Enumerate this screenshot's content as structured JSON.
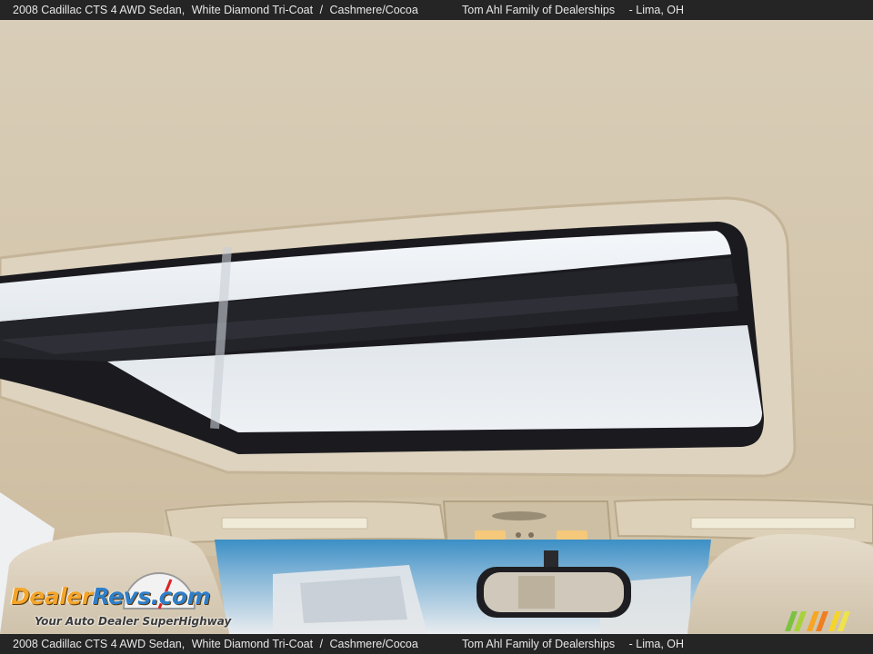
{
  "caption": {
    "vehicle": "2008 Cadillac CTS 4 AWD Sedan,",
    "color": "White Diamond Tri-Coat",
    "separator": "/",
    "interior": "Cashmere/Cocoa",
    "dealer": "Tom Ahl Family of Dealerships",
    "location": "-  Lima, OH"
  },
  "watermark": {
    "brand_part1": "Dealer",
    "brand_part2": "Revs",
    "brand_suffix": ".com",
    "tagline": "Your Auto Dealer SuperHighway"
  },
  "colors": {
    "caption_bar": "#252525",
    "headliner": "#d9ccb4",
    "logo_orange": "#f3a52a",
    "logo_blue": "#2f7fc8"
  }
}
